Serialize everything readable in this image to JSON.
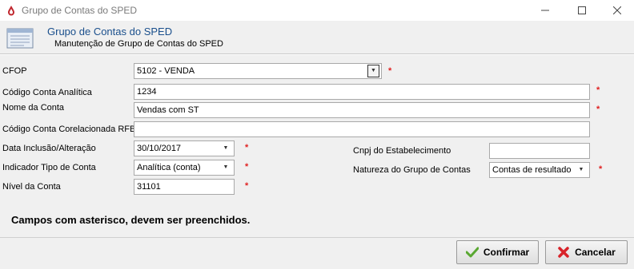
{
  "window": {
    "title": "Grupo de Contas do SPED",
    "minimize_icon": "minimize-icon",
    "maximize_icon": "maximize-icon",
    "close_icon": "close-icon"
  },
  "header": {
    "title": "Grupo de Contas do SPED",
    "subtitle": "Manutenção de Grupo de Contas do SPED",
    "icon": "form-list-icon"
  },
  "form": {
    "cfop": {
      "label": "CFOP",
      "value": "5102  - VENDA"
    },
    "codigo_conta": {
      "label": "Código Conta Analítica",
      "value": "1234"
    },
    "nome_conta": {
      "label": "Nome da Conta",
      "value": "Vendas com ST"
    },
    "codigo_rfb": {
      "label": "Código Conta Corelacionada RFB",
      "value": ""
    },
    "data": {
      "label": "Data Inclusão/Alteração",
      "value": "30/10/2017"
    },
    "indicador": {
      "label": "Indicador Tipo de Conta",
      "value": "Analítica (conta)"
    },
    "nivel": {
      "label": "Nível da Conta",
      "value": "31101"
    },
    "cnpj": {
      "label": "Cnpj do Estabelecimento",
      "value": ""
    },
    "natureza": {
      "label": "Natureza do Grupo de Contas",
      "value": "Contas de resultado"
    },
    "required_mark": "*",
    "note": "Campos com asterisco, devem ser preenchidos."
  },
  "buttons": {
    "confirm": "Confirmar",
    "cancel": "Cancelar"
  },
  "colors": {
    "header_title": "#1a4f8c",
    "required": "#e02020",
    "background": "#f0f0f0"
  }
}
